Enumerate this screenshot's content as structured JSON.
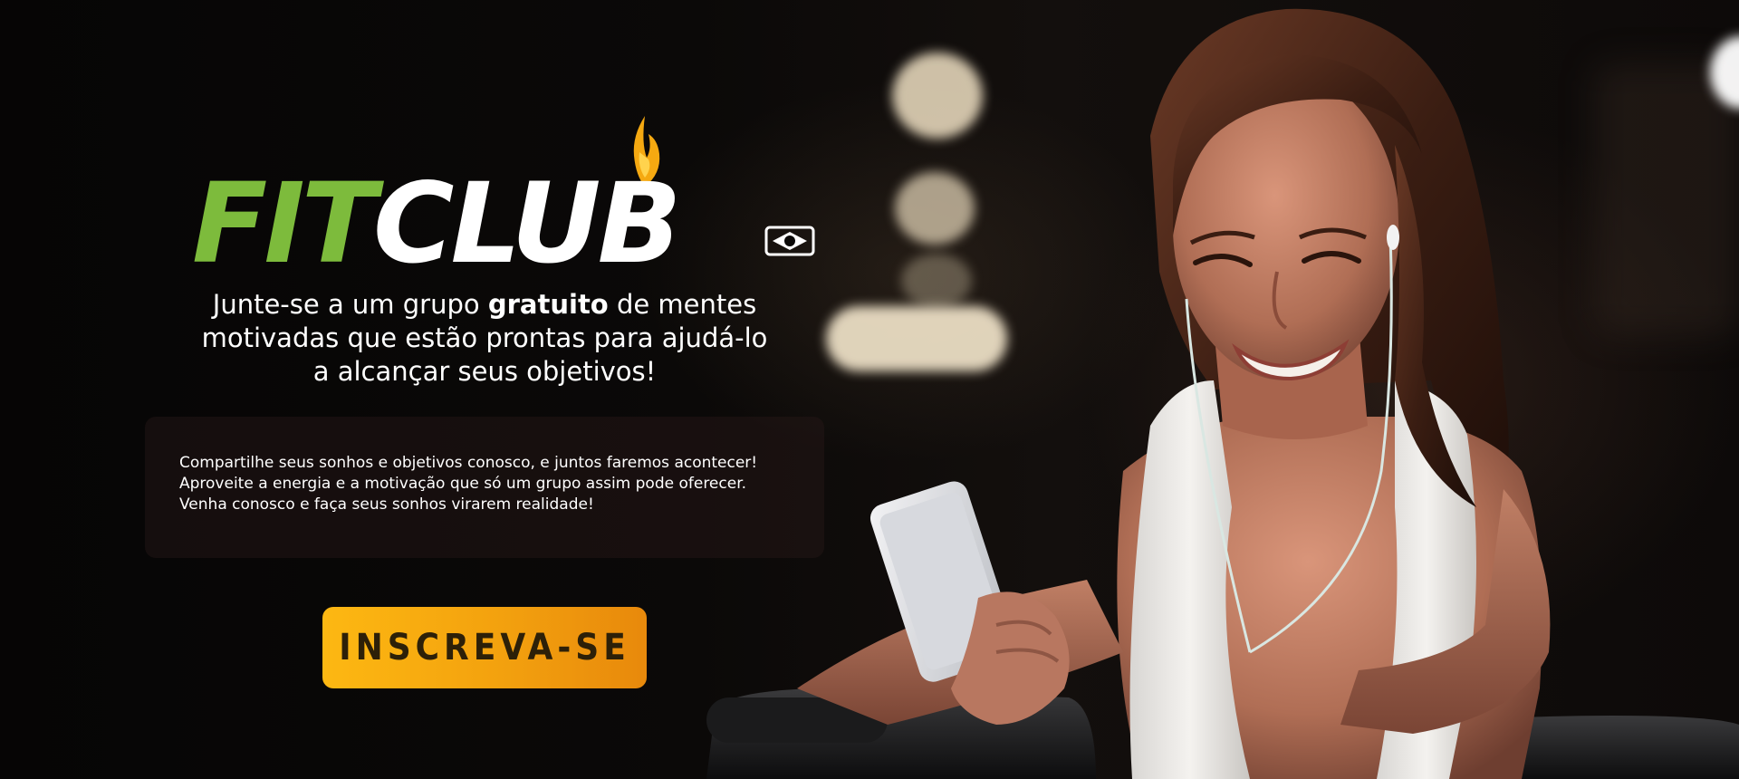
{
  "brand": {
    "logo_fit": "FIT",
    "logo_club": "CLUB",
    "fit_color": "#7dbb3c",
    "flame_color": "#f5a911"
  },
  "headline": {
    "part1": "Junte-se a um grupo ",
    "bold": "gratuito",
    "part2": " de mentes",
    "line2": "motivadas que estão prontas para ajudá-lo",
    "line3": "a alcançar seus objetivos!"
  },
  "info": {
    "lines": [
      "Compartilhe seus sonhos e objetivos conosco, e juntos faremos acontecer!",
      "Aproveite a energia e a motivação que só um grupo assim pode oferecer.",
      "Venha conosco e faça seus sonhos virarem realidade!"
    ]
  },
  "cta": {
    "label": "INSCREVA-SE",
    "color": "#f5a911"
  },
  "image": {
    "icon": "woman-with-phone-illustration"
  }
}
